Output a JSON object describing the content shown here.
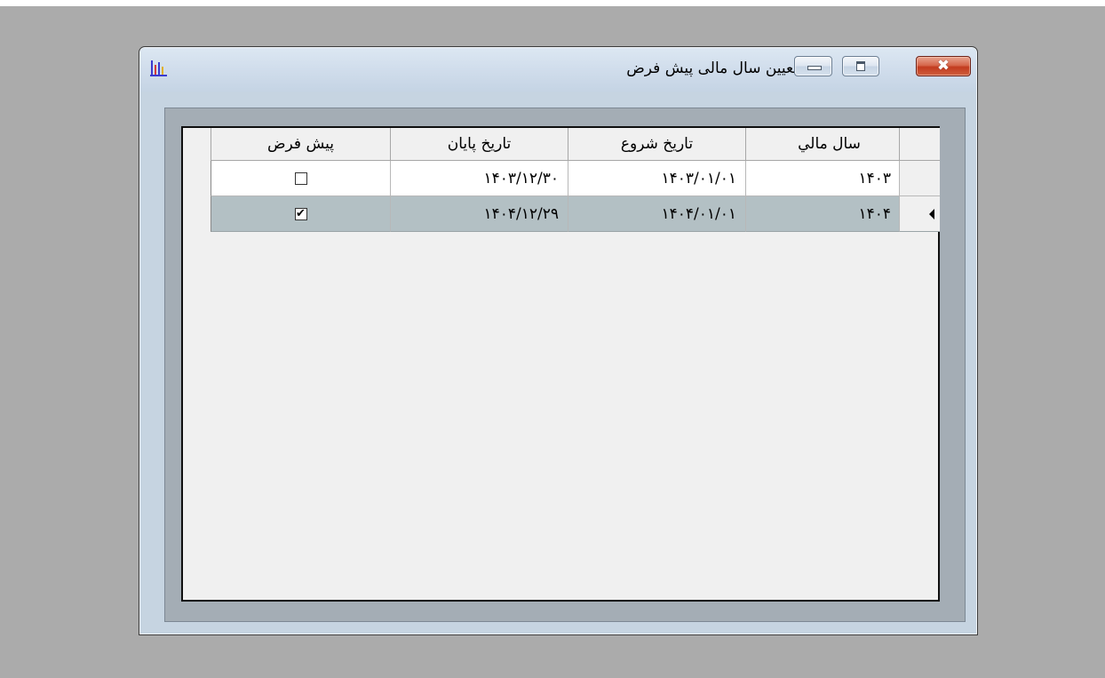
{
  "window": {
    "title": "تعیین سال مالی پیش فرض",
    "icon": "bar-chart-icon",
    "close_glyph": "✖"
  },
  "grid": {
    "columns": [
      "سال مالي",
      "تاريخ شروع",
      "تاريخ پايان",
      "پيش فرض"
    ],
    "rows": [
      {
        "year": "۱۴۰۳",
        "start": "۱۴۰۳/۰۱/۰۱",
        "end": "۱۴۰۳/۱۲/۳۰",
        "default": false,
        "default_glyph": "",
        "current": false
      },
      {
        "year": "۱۴۰۴",
        "start": "۱۴۰۴/۰۱/۰۱",
        "end": "۱۴۰۴/۱۲/۲۹",
        "default": true,
        "default_glyph": "✔",
        "current": true
      }
    ]
  },
  "colors": {
    "selected_row": "#b3c0c4",
    "titlebar": "#cfdceb",
    "close_button": "#c23b1f",
    "background": "#ababab"
  }
}
